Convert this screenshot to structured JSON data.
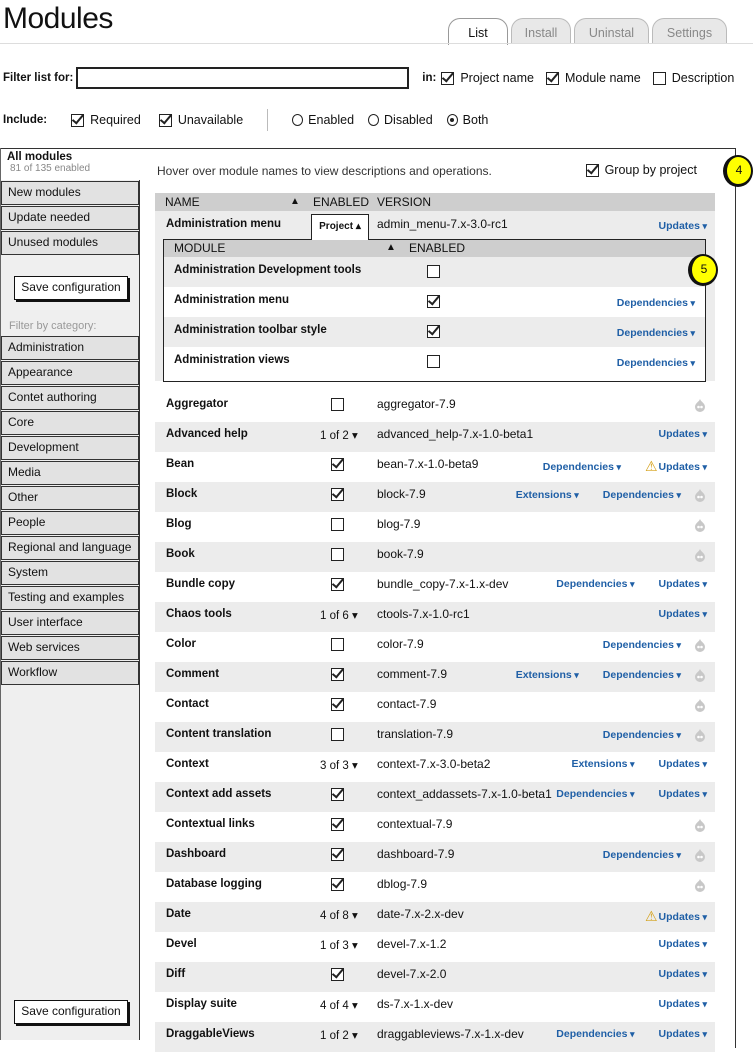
{
  "header": {
    "title": "Modules",
    "tabs": [
      {
        "label": "List",
        "active": true
      },
      {
        "label": "Install",
        "active": false
      },
      {
        "label": "Uninstal",
        "active": false
      },
      {
        "label": "Settings",
        "active": false
      }
    ]
  },
  "filter": {
    "label": "Filter list for:",
    "value": "",
    "in_label": "in:",
    "options": [
      {
        "label": "Project name",
        "checked": true
      },
      {
        "label": "Module name",
        "checked": true
      },
      {
        "label": "Description",
        "checked": false
      }
    ]
  },
  "include": {
    "label": "Include:",
    "checkboxes": [
      {
        "label": "Required",
        "checked": true
      },
      {
        "label": "Unavailable",
        "checked": true
      }
    ],
    "radios": [
      {
        "label": "Enabled",
        "selected": false
      },
      {
        "label": "Disabled",
        "selected": false
      },
      {
        "label": "Both",
        "selected": true
      }
    ]
  },
  "sidebar": {
    "all_modules": {
      "label": "All modules",
      "count_text": "81 of 135 enabled"
    },
    "views": [
      "New modules",
      "Update needed",
      "Unused modules"
    ],
    "save_label": "Save configuration",
    "filter_by_category_label": "Filter by category:",
    "categories": [
      "Administration",
      "Appearance",
      "Contet authoring",
      "Core",
      "Development",
      "Media",
      "Other",
      "People",
      "Regional and language",
      "System",
      "Testing and examples",
      "User interface",
      "Web services",
      "Workflow"
    ]
  },
  "main": {
    "hint": "Hover over module names to view descriptions and operations.",
    "group_by_project": {
      "label": "Group by project",
      "checked": true
    },
    "annotations": {
      "badge_4": "4",
      "badge_5": "5"
    },
    "columns": {
      "name": "NAME",
      "sort_indicator": "▲",
      "enabled": "ENABLED",
      "version": "VERSION"
    },
    "expanded_project": {
      "name": "Administration menu",
      "project_button": "Project ▴",
      "version": "admin_menu-7.x-3.0-rc1",
      "actions": [
        "Updates"
      ],
      "sub_columns": {
        "module": "MODULE",
        "sort_indicator": "▲",
        "enabled": "ENABLED"
      },
      "modules": [
        {
          "name": "Administration Development tools",
          "enabled": false,
          "actions": []
        },
        {
          "name": "Administration menu",
          "enabled": true,
          "actions": [
            "Dependencies"
          ]
        },
        {
          "name": "Administration toolbar style",
          "enabled": true,
          "actions": [
            "Dependencies"
          ]
        },
        {
          "name": "Administration views",
          "enabled": false,
          "actions": [
            "Dependencies"
          ]
        }
      ]
    },
    "rows": [
      {
        "name": "Aggregator",
        "enabled": false,
        "count": null,
        "version": "aggregator-7.9",
        "actions": [],
        "warning": false,
        "core_icon": true
      },
      {
        "name": "Advanced help",
        "enabled": null,
        "count": "1 of 2",
        "version": "advanced_help-7.x-1.0-beta1",
        "actions": [
          "Updates"
        ],
        "warning": false,
        "core_icon": false
      },
      {
        "name": "Bean",
        "enabled": true,
        "count": null,
        "version": "bean-7.x-1.0-beta9",
        "actions": [
          "Dependencies",
          "Updates"
        ],
        "warning": true,
        "core_icon": false
      },
      {
        "name": "Block",
        "enabled": true,
        "count": null,
        "version": "block-7.9",
        "actions": [
          "Extensions",
          "Dependencies"
        ],
        "warning": false,
        "core_icon": true
      },
      {
        "name": "Blog",
        "enabled": false,
        "count": null,
        "version": "blog-7.9",
        "actions": [],
        "warning": false,
        "core_icon": true
      },
      {
        "name": "Book",
        "enabled": false,
        "count": null,
        "version": "book-7.9",
        "actions": [],
        "warning": false,
        "core_icon": true
      },
      {
        "name": "Bundle copy",
        "enabled": true,
        "count": null,
        "version": "bundle_copy-7.x-1.x-dev",
        "actions": [
          "Dependencies",
          "Updates"
        ],
        "warning": false,
        "core_icon": false
      },
      {
        "name": "Chaos tools",
        "enabled": null,
        "count": "1 of 6",
        "version": "ctools-7.x-1.0-rc1",
        "actions": [
          "Updates"
        ],
        "warning": false,
        "core_icon": false
      },
      {
        "name": "Color",
        "enabled": false,
        "count": null,
        "version": "color-7.9",
        "actions": [
          "Dependencies"
        ],
        "warning": false,
        "core_icon": true
      },
      {
        "name": "Comment",
        "enabled": true,
        "count": null,
        "version": "comment-7.9",
        "actions": [
          "Extensions",
          "Dependencies"
        ],
        "warning": false,
        "core_icon": true
      },
      {
        "name": "Contact",
        "enabled": true,
        "count": null,
        "version": "contact-7.9",
        "actions": [],
        "warning": false,
        "core_icon": true
      },
      {
        "name": "Content translation",
        "enabled": false,
        "count": null,
        "version": "translation-7.9",
        "actions": [
          "Dependencies"
        ],
        "warning": false,
        "core_icon": true
      },
      {
        "name": "Context",
        "enabled": null,
        "count": "3 of 3",
        "version": "context-7.x-3.0-beta2",
        "actions": [
          "Extensions",
          "Updates"
        ],
        "warning": false,
        "core_icon": false
      },
      {
        "name": "Context add assets",
        "enabled": true,
        "count": null,
        "version": "context_addassets-7.x-1.0-beta1",
        "actions": [
          "Dependencies",
          "Updates"
        ],
        "warning": false,
        "core_icon": false
      },
      {
        "name": "Contextual links",
        "enabled": true,
        "count": null,
        "version": "contextual-7.9",
        "actions": [],
        "warning": false,
        "core_icon": true
      },
      {
        "name": "Dashboard",
        "enabled": true,
        "count": null,
        "version": "dashboard-7.9",
        "actions": [
          "Dependencies"
        ],
        "warning": false,
        "core_icon": true
      },
      {
        "name": "Database logging",
        "enabled": true,
        "count": null,
        "version": "dblog-7.9",
        "actions": [],
        "warning": false,
        "core_icon": true
      },
      {
        "name": "Date",
        "enabled": null,
        "count": "4 of 8",
        "version": "date-7.x-2.x-dev",
        "actions": [
          "Updates"
        ],
        "warning": true,
        "core_icon": false
      },
      {
        "name": "Devel",
        "enabled": null,
        "count": "1 of 3",
        "version": "devel-7.x-1.2",
        "actions": [
          "Updates"
        ],
        "warning": false,
        "core_icon": false
      },
      {
        "name": "Diff",
        "enabled": true,
        "count": null,
        "version": "devel-7.x-2.0",
        "actions": [
          "Updates"
        ],
        "warning": false,
        "core_icon": false
      },
      {
        "name": "Display suite",
        "enabled": null,
        "count": "4 of 4",
        "version": "ds-7.x-1.x-dev",
        "actions": [
          "Updates"
        ],
        "warning": false,
        "core_icon": false
      },
      {
        "name": "DraggableViews",
        "enabled": null,
        "count": "1 of 2",
        "version": "draggableviews-7.x-1.x-dev",
        "actions": [
          "Dependencies",
          "Updates"
        ],
        "warning": false,
        "core_icon": false
      }
    ]
  }
}
